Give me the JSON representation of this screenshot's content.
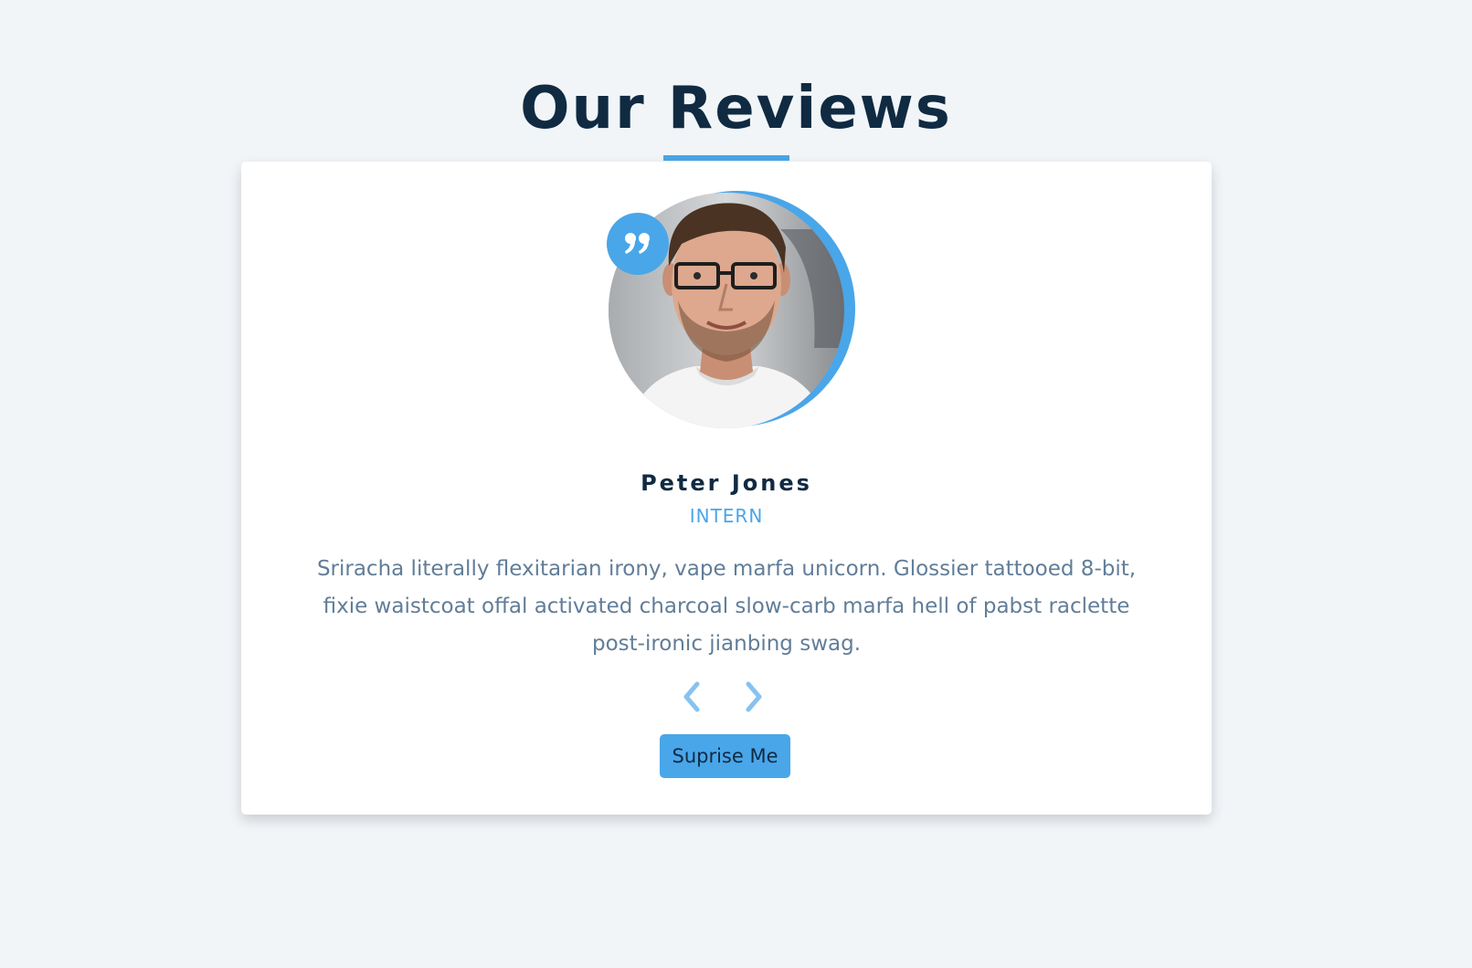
{
  "page": {
    "title": "Our Reviews"
  },
  "review": {
    "name": "Peter Jones",
    "job": "INTERN",
    "text": "Sriracha literally flexitarian irony, vape marfa unicorn. Glossier tattooed 8-bit, fixie waistcoat offal activated charcoal slow-carb marfa hell of pabst raclette post-ironic jianbing swag."
  },
  "controls": {
    "prev_icon": "chevron-left-icon",
    "next_icon": "chevron-right-icon",
    "random_label": "Suprise Me"
  },
  "icons": {
    "quote": "quote-icon"
  },
  "colors": {
    "background": "#f1f5f8",
    "primary": "#49a6e9",
    "heading": "#102a42",
    "text": "#617d98",
    "card": "#ffffff"
  }
}
